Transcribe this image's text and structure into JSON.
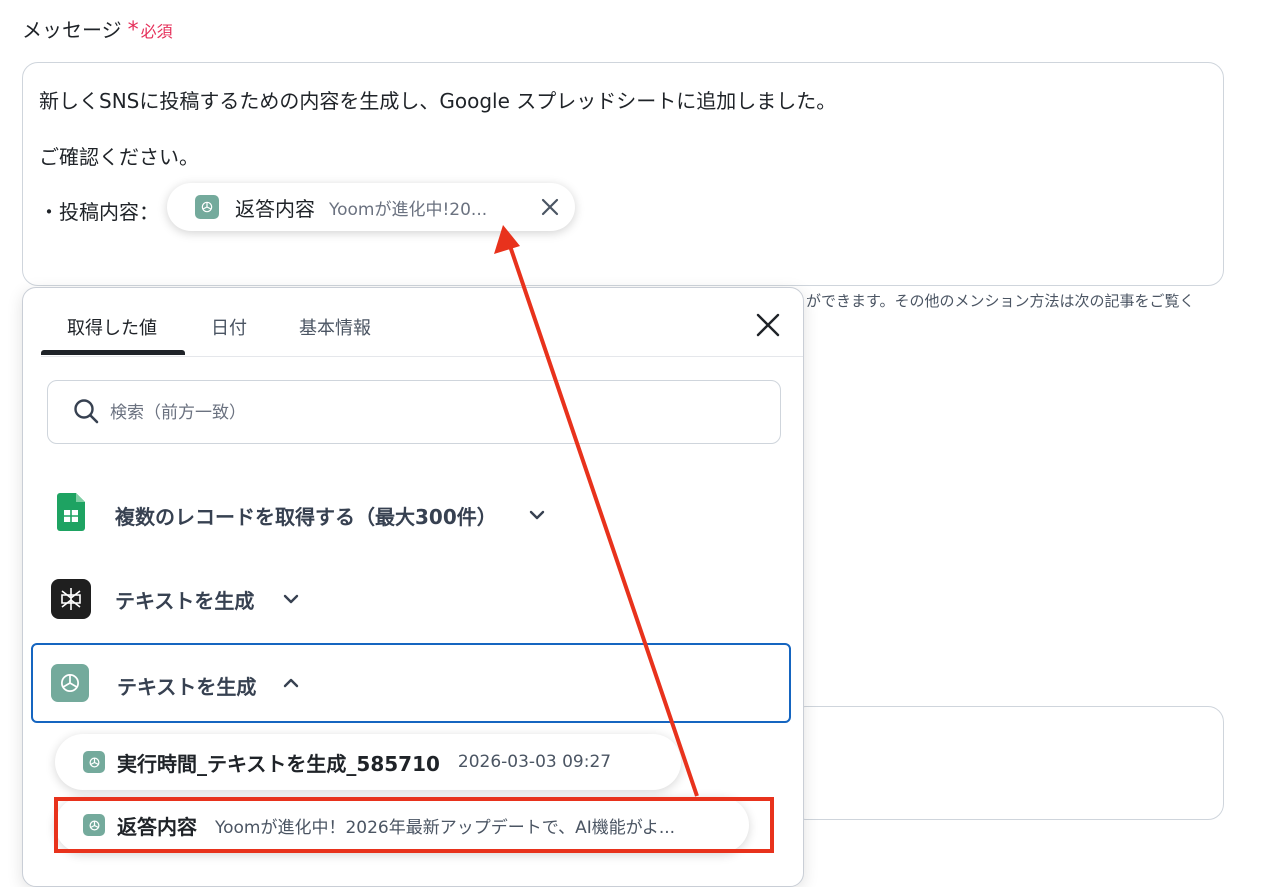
{
  "field": {
    "label": "メッセージ",
    "required_mark": "*",
    "required_text": "必須"
  },
  "message": {
    "line1": "新しくSNSに投稿するための内容を生成し、Google スプレッドシートに追加しました。",
    "line2": "ご確認ください。",
    "line3_prefix": "・投稿内容：",
    "chip": {
      "label": "返答内容",
      "value": "Yoomが進化中!20..."
    }
  },
  "helper_text": "ができます。その他のメンション方法は次の記事をご覧く",
  "popup": {
    "tabs": [
      "取得した値",
      "日付",
      "基本情報"
    ],
    "active_tab": 0,
    "search_placeholder": "検索（前方一致）",
    "groups": [
      {
        "title": "複数のレコードを取得する（最大300件）",
        "icon": "google-sheets-icon",
        "expanded": false
      },
      {
        "title": "テキストを生成",
        "icon": "perplexity-icon",
        "expanded": false
      },
      {
        "title": "テキストを生成",
        "icon": "chatgpt-icon",
        "expanded": true
      }
    ],
    "items": [
      {
        "label": "実行時間_テキストを生成_585710",
        "value": "2026-03-03 09:27"
      },
      {
        "label": "返答内容",
        "value": "Yoomが進化中！2026年最新アップデートで、AI機能がよ..."
      }
    ]
  },
  "colors": {
    "required": "#e5305a",
    "selected_border": "#1565c0",
    "highlight": "#e8321c",
    "chatgpt": "#74aa9c",
    "sheets": "#1ea362"
  }
}
